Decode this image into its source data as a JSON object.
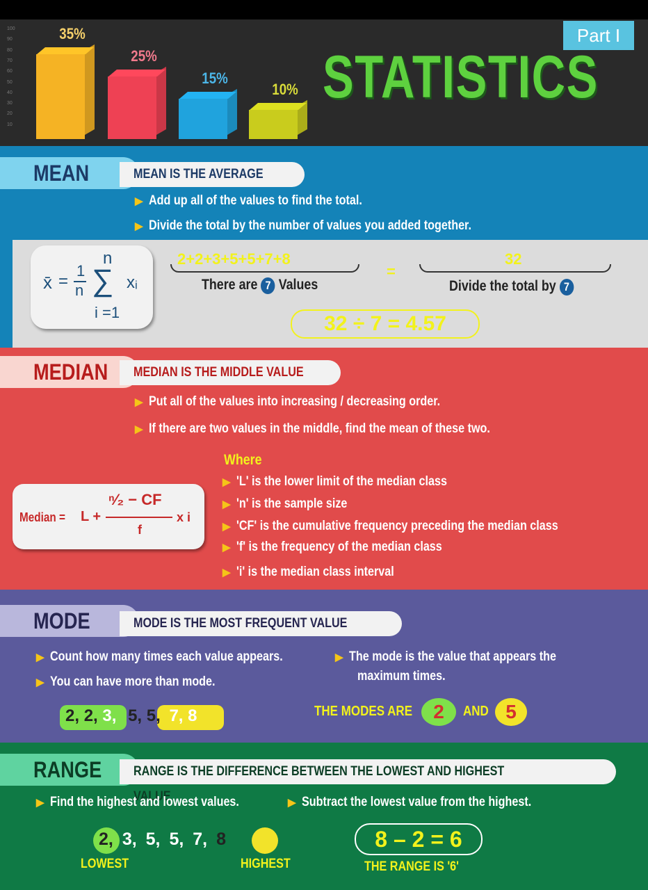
{
  "header": {
    "part_label": "Part I",
    "title": "STATISTICS",
    "axis_ticks": [
      "100",
      "90",
      "80",
      "70",
      "60",
      "50",
      "40",
      "30",
      "20",
      "10"
    ],
    "bars": [
      {
        "label": "35%",
        "value": 35,
        "color": "#f5b324"
      },
      {
        "label": "25%",
        "value": 25,
        "color": "#ee4154"
      },
      {
        "label": "15%",
        "value": 15,
        "color": "#20a3dd"
      },
      {
        "label": "10%",
        "value": 10,
        "color": "#c9cc1d"
      }
    ]
  },
  "mean": {
    "label": "MEAN",
    "heading": "MEAN IS THE AVERAGE",
    "bullets": [
      "Add up all of the values to find the total.",
      "Divide the total by the number of values you added together."
    ],
    "formula": {
      "xbar": "x̄",
      "eq": "=",
      "num": "1",
      "den": "n",
      "sigma": "∑",
      "upper": "n",
      "lower": "i =1",
      "term": "xᵢ"
    },
    "sum": "2+2+3+5+5+7+8",
    "equals": "=",
    "total": "32",
    "count_pre": "There are",
    "count": "7",
    "count_post": "Values",
    "divide_text": "Divide the total by",
    "divide_num": "7",
    "result": "32 ÷ 7 = 4.57"
  },
  "median": {
    "label": "MEDIAN",
    "heading": "MEDIAN IS THE MIDDLE VALUE",
    "bullets": [
      "Put all of the values into increasing / decreasing order.",
      "If there are two values in the middle, find the mean of these two."
    ],
    "where": "Where",
    "defs": [
      "'L' is the lower limit of the median class",
      "'n' is the sample size",
      "'CF' is the cumulative frequency preceding the median class",
      "'f' is the frequency of the median class",
      "'i' is the median class interval"
    ],
    "formula": {
      "lhs": "Median =",
      "L": "L +",
      "num": "ⁿ⁄₂ − CF",
      "den": "f",
      "times": "x i"
    }
  },
  "mode": {
    "label": "MODE",
    "heading": "MODE IS THE MOST FREQUENT VALUE",
    "bullets": [
      "Count how many times each value appears.",
      "You can have more than mode.",
      "The mode is the value that appears the",
      "maximum times."
    ],
    "values": [
      "2,",
      "2,",
      "3,",
      "5,",
      "5,",
      "7,",
      "8"
    ],
    "modes_text": "THE MODES ARE",
    "mode1": "2",
    "and": "AND",
    "mode2": "5"
  },
  "range": {
    "label": "RANGE",
    "heading": "RANGE IS THE DIFFERENCE BETWEEN THE LOWEST AND HIGHEST VALUE",
    "bullets": [
      "Find the highest and lowest values.",
      "Subtract the lowest value from the highest."
    ],
    "values": [
      "2,",
      "3,",
      "5,",
      "5,",
      "7,",
      "8"
    ],
    "lowest": "LOWEST",
    "highest": "HIGHEST",
    "calc": "8 – 2 = 6",
    "result": "THE RANGE IS '6'"
  }
}
